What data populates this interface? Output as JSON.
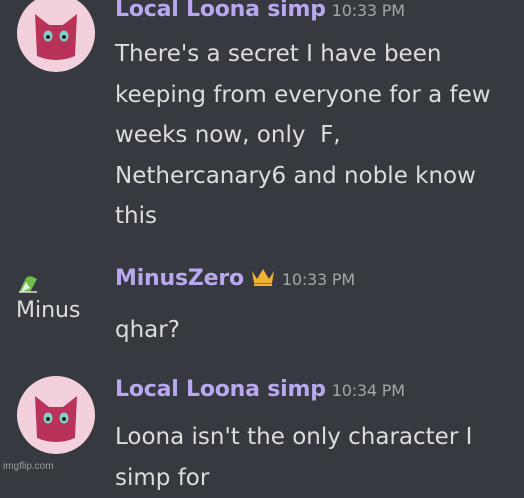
{
  "messages": [
    {
      "author": "Local Loona simp",
      "time": "10:33 PM",
      "text": "There's a secret I have been keeping from everyone for a few weeks now, only  F, Nethercanary6 and noble know this"
    },
    {
      "author": "MinusZero",
      "time": "10:33 PM",
      "avatar_alt": "Minus",
      "badge_icon": "crown-icon",
      "text": "qhar?"
    },
    {
      "author": "Local Loona simp",
      "time": "10:34 PM",
      "text": "Loona isn't the only character I simp for"
    }
  ],
  "watermark": "imgflip.com",
  "colors": {
    "background": "#36393f",
    "username": "#b9a8ef",
    "timestamp": "#a3a6aa",
    "message_text": "#dcddde",
    "crown": "#f0b232",
    "avatar_bg": "#f3d1dc",
    "avatar_face": "#b8325a"
  }
}
